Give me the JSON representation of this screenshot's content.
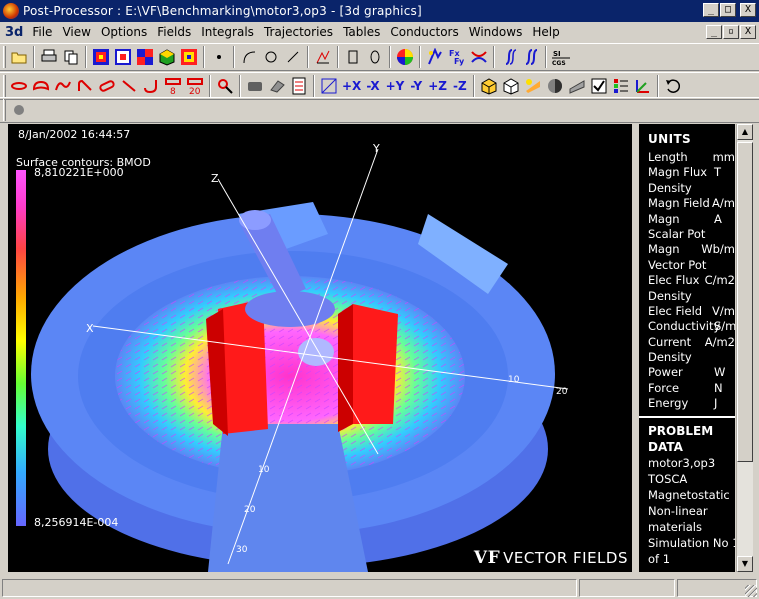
{
  "window": {
    "title": "Post-Processor : E:\\VF\\Benchmarking\\motor3,op3 - [3d graphics]",
    "minimize": "_",
    "restore": "□",
    "close": "X"
  },
  "menubar": {
    "doc_icon": "3d",
    "items": [
      "File",
      "View",
      "Options",
      "Fields",
      "Integrals",
      "Trajectories",
      "Tables",
      "Conductors",
      "Windows",
      "Help"
    ],
    "mdi_min": "_",
    "mdi_restore": "▫",
    "mdi_close": "X"
  },
  "toolbar_axis": {
    "px": "+X",
    "mx": "-X",
    "py": "+Y",
    "my": "-Y",
    "pz": "+Z",
    "mz": "-Z"
  },
  "toolbar_icons": {
    "row1": [
      "open-icon",
      "print-icon",
      "copy-icon",
      "contour-icon",
      "mesh-icon",
      "colors-icon",
      "cube-icon",
      "palette-icon",
      "point-icon",
      "arc-icon",
      "circle-icon",
      "line-icon",
      "graph-icon",
      "rectangle-icon",
      "ellipse-icon",
      "color-wheel-icon",
      "field-icon",
      "flux-icon",
      "link-icon",
      "integral-icon",
      "double-integral-icon",
      "units-icon"
    ],
    "row2": [
      "ellipse-red-icon",
      "loop-icon",
      "curve-icon",
      "bend-icon",
      "bar-icon",
      "line-red-icon",
      "hook-icon",
      "coil8-icon",
      "coil20-icon",
      "pick-icon",
      "box-icon",
      "eraser-icon",
      "list-icon",
      "view3d-icon",
      "iso-cube-icon",
      "wire-cube-icon",
      "light-icon",
      "shading-icon",
      "hatch-icon",
      "check-icon",
      "legend-icon",
      "axes-icon",
      "rotate-icon"
    ],
    "row3": [
      "record-icon"
    ]
  },
  "units_label": "UNITS",
  "toolbar_units_label": "SI\nCGS",
  "graphics": {
    "timestamp": "8/Jan/2002 16:44:57",
    "contour_label": "Surface contours: BMOD",
    "max_value": "8,810221E+000",
    "min_value": "8,256914E-004",
    "axis_labels": [
      "X",
      "Y",
      "Z",
      "10",
      "20",
      "30",
      "10",
      "20"
    ],
    "logo": "VECTOR FIELDS",
    "logo_mark": "VF"
  },
  "side_panel": {
    "units_heading": "UNITS",
    "units": [
      {
        "name": "Length",
        "unit": "mm"
      },
      {
        "name": "Magn Flux",
        "unit": "T"
      },
      {
        "name": "Density",
        "unit": ""
      },
      {
        "name": "Magn Field",
        "unit": "A/m"
      },
      {
        "name": "Magn",
        "unit": "A"
      },
      {
        "name": "Scalar Pot",
        "unit": ""
      },
      {
        "name": "Magn",
        "unit": "Wb/m"
      },
      {
        "name": "Vector Pot",
        "unit": ""
      },
      {
        "name": "Elec Flux",
        "unit": "C/m2"
      },
      {
        "name": "Density",
        "unit": ""
      },
      {
        "name": "Elec Field",
        "unit": "V/m"
      },
      {
        "name": "Conductivity",
        "unit": "S/m"
      },
      {
        "name": "Current",
        "unit": "A/m2"
      },
      {
        "name": "Density",
        "unit": ""
      },
      {
        "name": "Power",
        "unit": "W"
      },
      {
        "name": "Force",
        "unit": "N"
      },
      {
        "name": "Energy",
        "unit": "J"
      }
    ],
    "problem_heading_1": "PROBLEM",
    "problem_heading_2": "DATA",
    "problem_lines": [
      "motor3,op3",
      "TOSCA",
      "Magnetostatic",
      "Non-linear",
      "materials",
      "Simulation No 1",
      "of 1"
    ]
  },
  "colors": {
    "titlebar": "#0a246a",
    "chrome": "#d4d0c8",
    "graphics_bg": "#000000",
    "housing": "#5b86f5",
    "coil": "#ff1a1a",
    "shaft": "#6f7ef0",
    "field_high": "#ff33cc"
  }
}
